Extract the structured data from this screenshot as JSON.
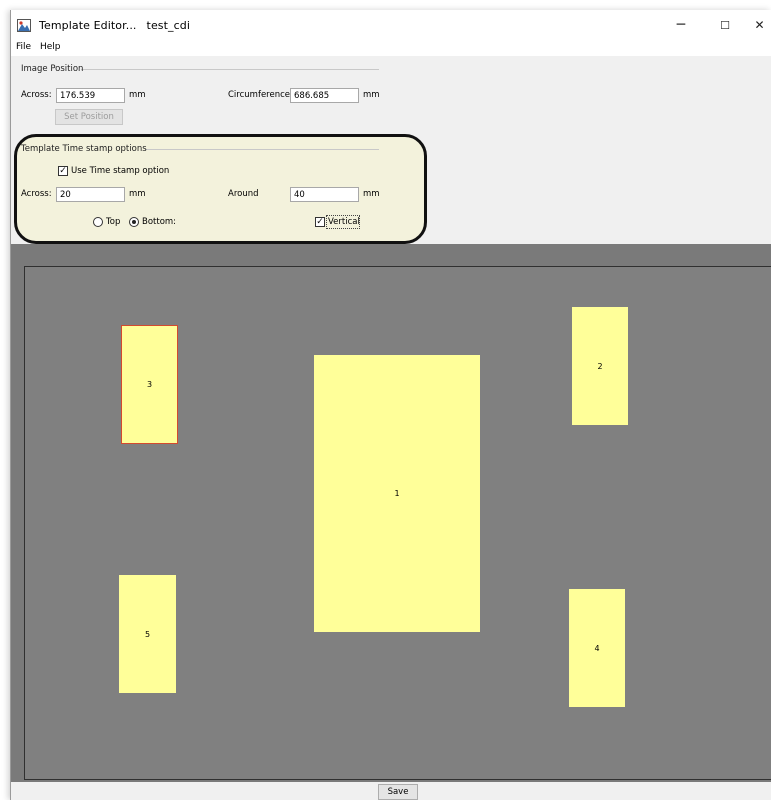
{
  "window": {
    "title": "Template Editor...",
    "file_name": "test_cdi",
    "minimize_glyph": "─",
    "maximize_glyph": "☐",
    "close_glyph": "✕"
  },
  "menu": [
    "File",
    "Help"
  ],
  "image_position": {
    "group_label": "Image Position",
    "across_label": "Across:",
    "across_value": "176.539",
    "across_unit": "mm",
    "circumference_label": "Circumference:",
    "circumference_value": "686.685",
    "circumference_unit": "mm",
    "set_position_label": "Set Position"
  },
  "timestamp": {
    "group_label": "Template Time stamp options",
    "use_option_label": "Use Time stamp option",
    "use_option_checked": true,
    "across_label": "Across:",
    "across_value": "20",
    "across_unit": "mm",
    "around_label": "Around",
    "around_value": "40",
    "around_unit": "mm",
    "top_label": "Top",
    "bottom_label": "Bottom:",
    "selected_position": "Bottom",
    "vertical_label": "Vertical",
    "vertical_checked": true
  },
  "blocks": [
    "1",
    "2",
    "3",
    "4",
    "5"
  ],
  "save_label": "Save",
  "colors": {
    "canvas": "#808080",
    "block": "#ffff99",
    "selected_border": "#d44a2e",
    "highlight_fill": "#f3f2dc"
  }
}
